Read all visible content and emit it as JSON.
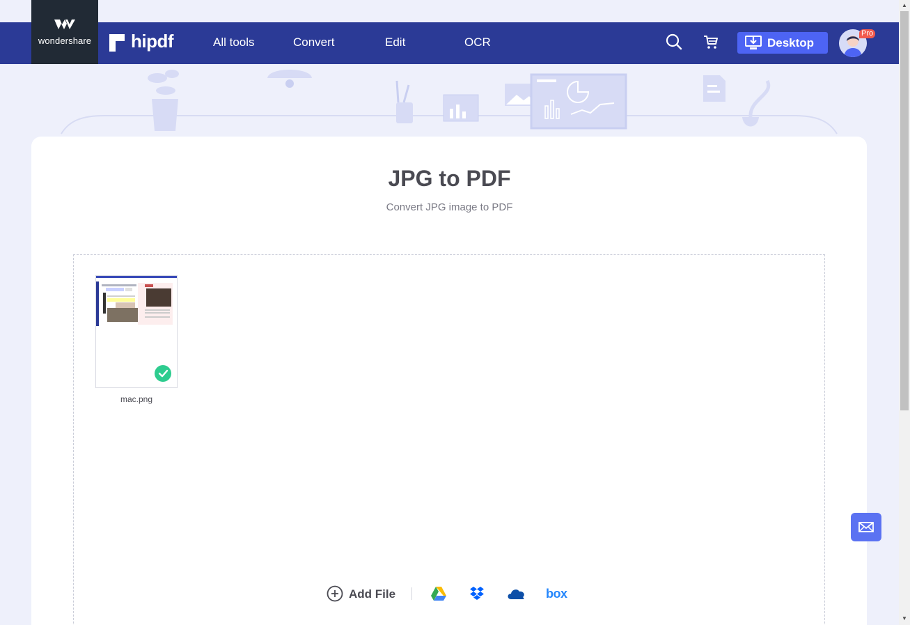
{
  "brand": {
    "company": "wondershare",
    "product": "hipdf"
  },
  "nav": {
    "items": [
      "All tools",
      "Convert",
      "Edit",
      "OCR"
    ],
    "desktop_label": "Desktop",
    "pro_badge": "Pro"
  },
  "icons": {
    "search": "search-icon",
    "cart": "cart-icon",
    "desktop": "download-desktop-icon",
    "add": "plus-circle-icon",
    "gdrive": "google-drive-icon",
    "dropbox": "dropbox-icon",
    "onedrive": "onedrive-icon",
    "box": "box-icon",
    "mail": "mail-icon",
    "check": "check-icon"
  },
  "page": {
    "title": "JPG to PDF",
    "subtitle": "Convert JPG image to PDF"
  },
  "files": [
    {
      "name": "mac.png",
      "status": "ready"
    }
  ],
  "upload": {
    "add_file_label": "Add File",
    "box_label": "box"
  },
  "colors": {
    "nav_bg": "#2b3a96",
    "accent": "#4d64f4",
    "success": "#2ecc8f",
    "pro": "#f25a4d"
  }
}
